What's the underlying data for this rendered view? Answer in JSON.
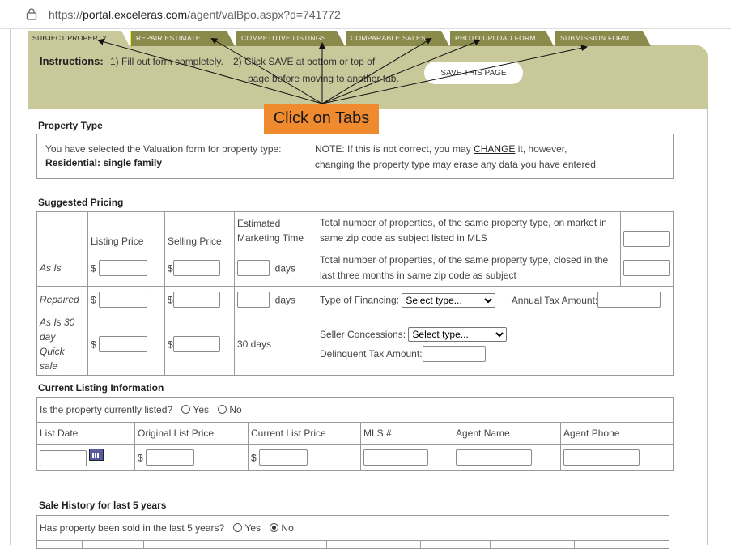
{
  "browser": {
    "url_prefix": "https://",
    "url_domain": "portal.exceleras.com",
    "url_path": "/agent/valBpo.aspx?d=741772"
  },
  "tabs": [
    {
      "label": "SUBJECT PROPERTY"
    },
    {
      "label": "REPAIR ESTIMATE"
    },
    {
      "label": "COMPETITIVE LISTINGS"
    },
    {
      "label": "COMPARABLE SALES"
    },
    {
      "label": "PHOTO UPLOAD FORM"
    },
    {
      "label": "SUBMISSION FORM"
    }
  ],
  "instructions": {
    "label": "Instructions:",
    "step1": "1) Fill out form completely.",
    "step2": "2) Click SAVE at bottom or top of",
    "step2b": "page before moving to another tab.",
    "save_button": "SAVE THIS PAGE"
  },
  "callout": "Click on Tabs",
  "property_type": {
    "title": "Property Type",
    "selected_text": "You have selected the Valuation form for property type:",
    "selected_value": "Residential: single family",
    "note_prefix": "NOTE: If this is not correct, you may",
    "note_link": "CHANGE",
    "note_suffix": "it, however,",
    "note_line2": "changing the property type may erase any data you have entered."
  },
  "pricing": {
    "title": "Suggested Pricing",
    "headers": {
      "listing": "Listing Price",
      "selling": "Selling Price",
      "marketing_l1": "Estimated",
      "marketing_l2": "Marketing Time",
      "market_note_l1": "Total number of properties, of the same property type, on market in",
      "market_note_l2": "same zip code as subject listed in MLS"
    },
    "rows": {
      "as_is": "As Is",
      "repaired": "Repaired",
      "quick_l1": "As Is 30",
      "quick_l2": "day",
      "quick_l3": "Quick sale"
    },
    "currency": "$",
    "days": "days",
    "thirty_days": "30 days",
    "closed_note_l1": "Total number of properties, of the same property type, closed in the",
    "closed_note_l2": "last three months in same zip code as subject",
    "financing_label": "Type of Financing:",
    "financing_selected": "Select type...",
    "tax_label": "Annual Tax Amount:",
    "concessions_label": "Seller Concessions:",
    "concessions_selected": "Select type...",
    "delinquent_label": "Delinquent Tax Amount:"
  },
  "listing": {
    "title": "Current Listing Information",
    "question": "Is the property currently listed?",
    "yes": "Yes",
    "no": "No",
    "columns": [
      "List Date",
      "Original List Price",
      "Current List Price",
      "MLS #",
      "Agent Name",
      "Agent Phone"
    ],
    "currency": "$"
  },
  "sale_history": {
    "title": "Sale History for last 5 years",
    "question": "Has property been sold in the last 5 years?",
    "yes": "Yes",
    "no": "No",
    "selected": "No"
  }
}
